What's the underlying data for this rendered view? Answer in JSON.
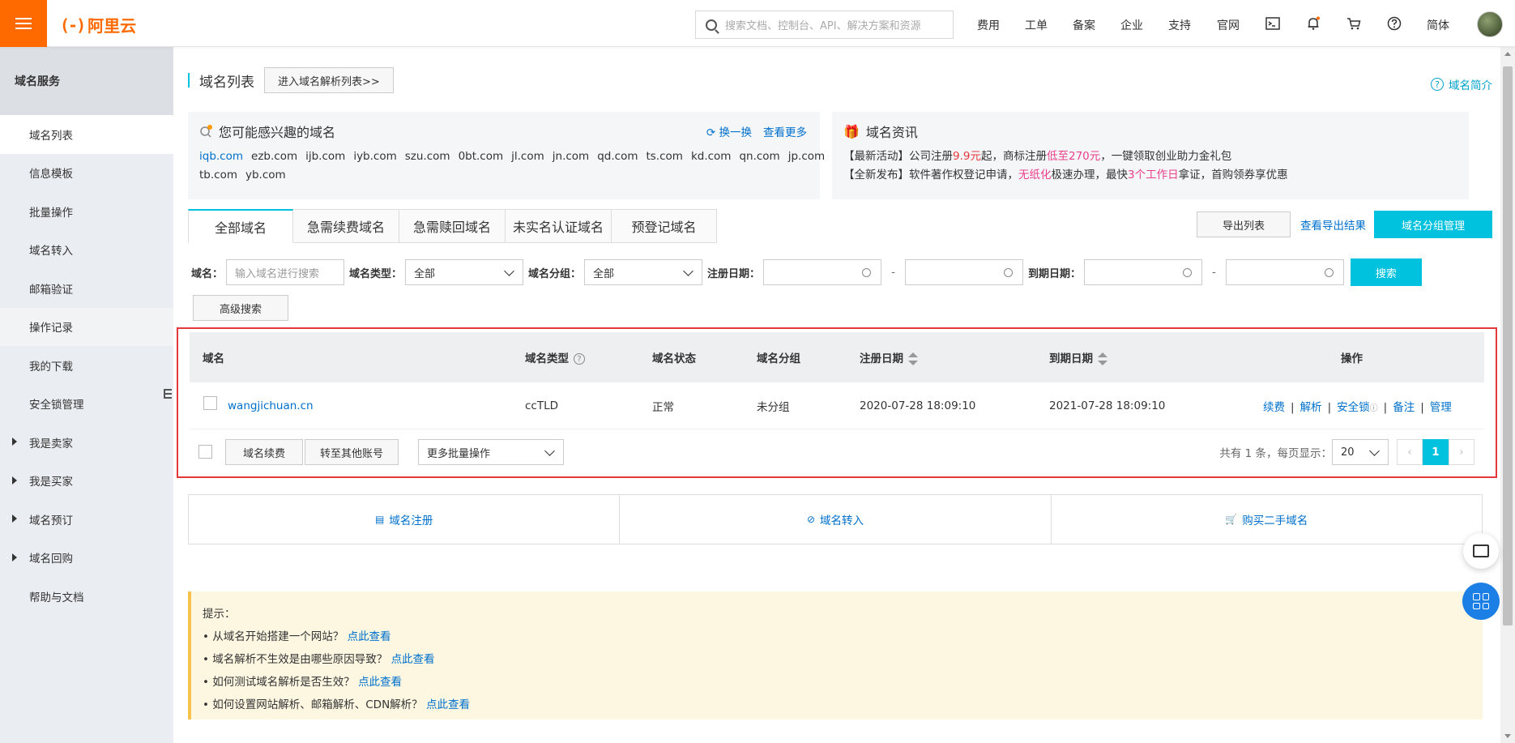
{
  "topbar": {
    "logo_text": "阿里云",
    "search_placeholder": "搜索文档、控制台、API、解决方案和资源",
    "nav": [
      "费用",
      "工单",
      "备案",
      "企业",
      "支持",
      "官网"
    ],
    "lang": "简体"
  },
  "sidebar": {
    "header": "域名服务",
    "items": [
      {
        "label": "域名列表",
        "expandable": false
      },
      {
        "label": "信息模板",
        "expandable": false
      },
      {
        "label": "批量操作",
        "expandable": false
      },
      {
        "label": "域名转入",
        "expandable": false
      },
      {
        "label": "邮箱验证",
        "expandable": false
      },
      {
        "label": "操作记录",
        "expandable": false
      },
      {
        "label": "我的下载",
        "expandable": false
      },
      {
        "label": "安全锁管理",
        "expandable": false
      },
      {
        "label": "我是卖家",
        "expandable": true
      },
      {
        "label": "我是买家",
        "expandable": true
      },
      {
        "label": "域名预订",
        "expandable": true
      },
      {
        "label": "域名回购",
        "expandable": true
      },
      {
        "label": "帮助与文档",
        "expandable": false
      }
    ]
  },
  "page": {
    "title": "域名列表",
    "dns_button": "进入域名解析列表>>",
    "intro_link": "域名简介"
  },
  "suggest": {
    "title": "您可能感兴趣的域名",
    "refresh": "换一换",
    "more": "查看更多",
    "domains": [
      "iqb.com",
      "ezb.com",
      "ijb.com",
      "iyb.com",
      "szu.com",
      "0bt.com",
      "jl.com",
      "jn.com",
      "qd.com",
      "ts.com",
      "kd.com",
      "qn.com",
      "jp.com",
      "tb.com",
      "yb.com"
    ]
  },
  "news": {
    "title": "域名资讯",
    "line1": {
      "a": "【最新活动】公司注册",
      "b": "9.9元",
      "c": "起，商标注册",
      "d": "低至270元",
      "e": "，一键领取创业助力金礼包"
    },
    "line2": {
      "a": "【全新发布】软件著作权登记申请，",
      "b": "无纸化",
      "c": "极速办理，最快",
      "d": "3个工作日",
      "e": "拿证，首购领券享优惠"
    }
  },
  "tabs": [
    "全部域名",
    "急需续费域名",
    "急需赎回域名",
    "未实名认证域名",
    "预登记域名"
  ],
  "actions": {
    "export": "导出列表",
    "view_export": "查看导出结果",
    "group_manage": "域名分组管理"
  },
  "filters": {
    "domain_label": "域名：",
    "domain_placeholder": "输入域名进行搜索",
    "type_label": "域名类型：",
    "type_value": "全部",
    "group_label": "域名分组：",
    "group_value": "全部",
    "reg_label": "注册日期：",
    "exp_label": "到期日期：",
    "dash": "-",
    "search": "搜索",
    "advanced": "高级搜索"
  },
  "table": {
    "headers": {
      "name": "域名",
      "type": "域名类型",
      "status": "域名状态",
      "group": "域名分组",
      "reg": "注册日期",
      "exp": "到期日期",
      "ops": "操作"
    },
    "rows": [
      {
        "name": "wangjichuan.cn",
        "type": "ccTLD",
        "status": "正常",
        "group": "未分组",
        "reg": "2020-07-28 18:09:10",
        "exp": "2021-07-28 18:09:10"
      }
    ],
    "ops": [
      "续费",
      "解析",
      "安全锁",
      "备注",
      "管理"
    ],
    "footer": {
      "renew": "域名续费",
      "transfer": "转至其他账号",
      "batch": "更多批量操作",
      "total": "共有 1 条，每页显示：",
      "page_size": "20",
      "page": "1"
    }
  },
  "quick": [
    "域名注册",
    "域名转入",
    "购买二手域名"
  ],
  "tips": {
    "title": "提示：",
    "items": [
      {
        "text": "• 从域名开始搭建一个网站？",
        "link": "点此查看"
      },
      {
        "text": "• 域名解析不生效是由哪些原因导致？",
        "link": "点此查看"
      },
      {
        "text": "• 如何测试域名解析是否生效？",
        "link": "点此查看"
      },
      {
        "text": "• 如何设置网站解析、邮箱解析、CDN解析？",
        "link": "点此查看"
      }
    ]
  },
  "colors": {
    "brand": "#ff6a00",
    "accent": "#00c1de",
    "link": "#0070cc",
    "highlight_box": "#e4393c"
  }
}
